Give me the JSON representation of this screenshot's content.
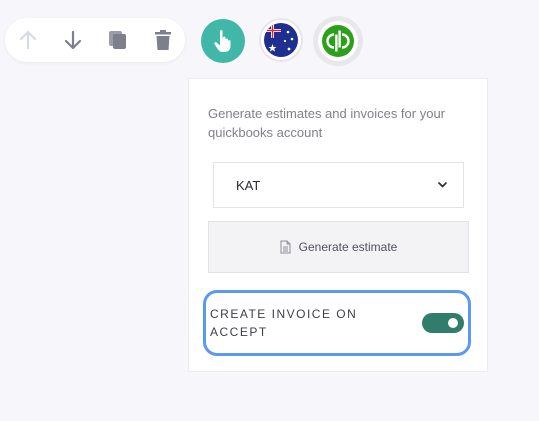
{
  "toolbar": {
    "move_up_icon": "arrow-up-icon",
    "move_down_icon": "arrow-down-icon",
    "duplicate_icon": "copy-icon",
    "delete_icon": "trash-icon"
  },
  "integrations": {
    "pointer_icon": "hand-pointer-icon",
    "pointer_color": "#41b8a7",
    "flag_icon": "australia-flag-icon",
    "quickbooks_icon": "quickbooks-logo",
    "quickbooks_color": "#2ca01c"
  },
  "panel": {
    "description": "Generate estimates and invoices for your quickbooks account",
    "select_value": "KAT",
    "generate_label": "Generate estimate",
    "toggle_label": "CREATE INVOICE ON ACCEPT",
    "toggle_on": true,
    "toggle_color": "#2f7d6a",
    "highlight_color": "#5b98f0"
  }
}
